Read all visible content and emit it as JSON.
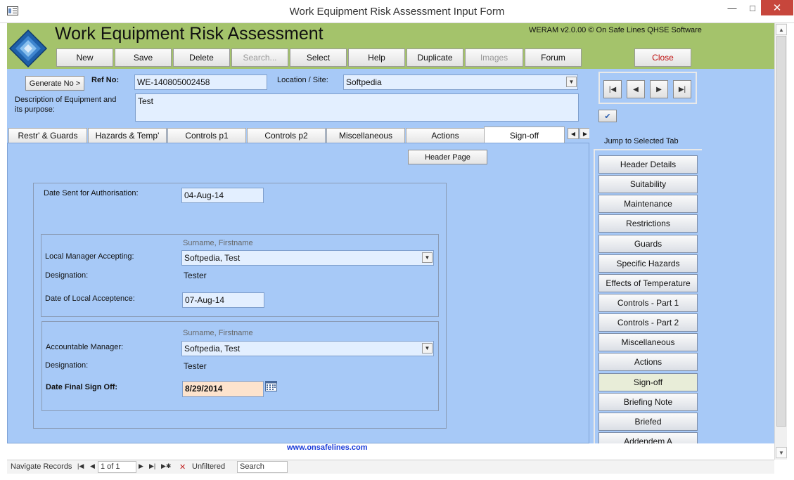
{
  "window": {
    "title": "Work Equipment Risk Assessment Input Form",
    "min_glyph": "—",
    "max_glyph": "□",
    "close_glyph": "✕"
  },
  "header": {
    "title": "Work Equipment Risk Assessment",
    "version": "WERAM v2.0.00 © On Safe Lines QHSE Software",
    "toolbar": {
      "new": "New",
      "save": "Save",
      "delete": "Delete",
      "search": "Search...",
      "select": "Select",
      "help": "Help",
      "duplicate": "Duplicate",
      "images": "Images",
      "forum": "Forum",
      "close": "Close"
    }
  },
  "form": {
    "generate_btn": "Generate No >",
    "ref_label": "Ref No:",
    "ref_value": "WE-140805002458",
    "location_label": "Location / Site:",
    "location_value": "Softpedia",
    "description_label": "Description of Equipment and its purpose:",
    "description_value": "Test"
  },
  "tabs": [
    {
      "label": "Restr' & Guards"
    },
    {
      "label": "Hazards & Temp'"
    },
    {
      "label": "Controls p1"
    },
    {
      "label": "Controls p2"
    },
    {
      "label": "Miscellaneous"
    },
    {
      "label": "Actions"
    },
    {
      "label": "Sign-off"
    }
  ],
  "signoff": {
    "header_page_btn": "Header Page",
    "date_sent_label": "Date Sent for Authorisation:",
    "date_sent_value": "04-Aug-14",
    "name_hint": "Surname, Firstname",
    "local_mgr_label": "Local Manager Accepting:",
    "local_mgr_value": "Softpedia, Test",
    "designation_label": "Designation:",
    "local_designation": "Tester",
    "local_date_label": "Date of Local Acceptence:",
    "local_date_value": "07-Aug-14",
    "acct_mgr_label": "Accountable Manager:",
    "acct_mgr_value": "Softpedia, Test",
    "acct_designation": "Tester",
    "final_label": "Date Final Sign Off:",
    "final_value": "8/29/2014"
  },
  "jump": {
    "label": "Jump to Selected Tab",
    "items": [
      "Header Details",
      "Suitability",
      "Maintenance",
      "Restrictions",
      "Guards",
      "Specific Hazards",
      "Effects of Temperature",
      "Controls - Part 1",
      "Controls - Part 2",
      "Miscellaneous",
      "Actions",
      "Sign-off",
      "Briefing Note",
      "Briefed",
      "Addendem A"
    ],
    "active": "Sign-off"
  },
  "footer": {
    "link": "www.onsafelines.com",
    "nav_label": "Navigate Records",
    "record_box": "1 of 1",
    "filter": "Unfiltered",
    "search": "Search"
  },
  "colors": {
    "header_green": "#a4c36b",
    "form_blue": "#a7c9f7",
    "field_blue": "#e3efff",
    "final_date_bg": "#fde3cd",
    "link_blue": "#1a3bd8"
  }
}
